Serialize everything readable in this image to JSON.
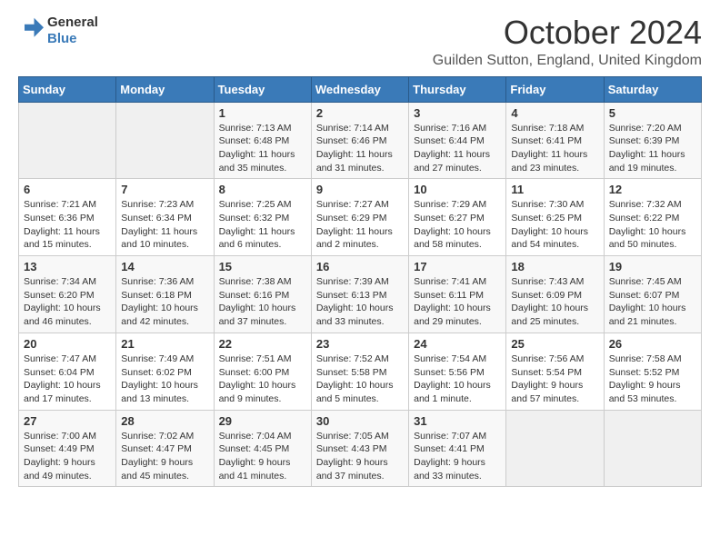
{
  "logo": {
    "text_general": "General",
    "text_blue": "Blue"
  },
  "header": {
    "month_title": "October 2024",
    "location": "Guilden Sutton, England, United Kingdom"
  },
  "days_of_week": [
    "Sunday",
    "Monday",
    "Tuesday",
    "Wednesday",
    "Thursday",
    "Friday",
    "Saturday"
  ],
  "weeks": [
    [
      {
        "day": "",
        "info": ""
      },
      {
        "day": "",
        "info": ""
      },
      {
        "day": "1",
        "info": "Sunrise: 7:13 AM\nSunset: 6:48 PM\nDaylight: 11 hours and 35 minutes."
      },
      {
        "day": "2",
        "info": "Sunrise: 7:14 AM\nSunset: 6:46 PM\nDaylight: 11 hours and 31 minutes."
      },
      {
        "day": "3",
        "info": "Sunrise: 7:16 AM\nSunset: 6:44 PM\nDaylight: 11 hours and 27 minutes."
      },
      {
        "day": "4",
        "info": "Sunrise: 7:18 AM\nSunset: 6:41 PM\nDaylight: 11 hours and 23 minutes."
      },
      {
        "day": "5",
        "info": "Sunrise: 7:20 AM\nSunset: 6:39 PM\nDaylight: 11 hours and 19 minutes."
      }
    ],
    [
      {
        "day": "6",
        "info": "Sunrise: 7:21 AM\nSunset: 6:36 PM\nDaylight: 11 hours and 15 minutes."
      },
      {
        "day": "7",
        "info": "Sunrise: 7:23 AM\nSunset: 6:34 PM\nDaylight: 11 hours and 10 minutes."
      },
      {
        "day": "8",
        "info": "Sunrise: 7:25 AM\nSunset: 6:32 PM\nDaylight: 11 hours and 6 minutes."
      },
      {
        "day": "9",
        "info": "Sunrise: 7:27 AM\nSunset: 6:29 PM\nDaylight: 11 hours and 2 minutes."
      },
      {
        "day": "10",
        "info": "Sunrise: 7:29 AM\nSunset: 6:27 PM\nDaylight: 10 hours and 58 minutes."
      },
      {
        "day": "11",
        "info": "Sunrise: 7:30 AM\nSunset: 6:25 PM\nDaylight: 10 hours and 54 minutes."
      },
      {
        "day": "12",
        "info": "Sunrise: 7:32 AM\nSunset: 6:22 PM\nDaylight: 10 hours and 50 minutes."
      }
    ],
    [
      {
        "day": "13",
        "info": "Sunrise: 7:34 AM\nSunset: 6:20 PM\nDaylight: 10 hours and 46 minutes."
      },
      {
        "day": "14",
        "info": "Sunrise: 7:36 AM\nSunset: 6:18 PM\nDaylight: 10 hours and 42 minutes."
      },
      {
        "day": "15",
        "info": "Sunrise: 7:38 AM\nSunset: 6:16 PM\nDaylight: 10 hours and 37 minutes."
      },
      {
        "day": "16",
        "info": "Sunrise: 7:39 AM\nSunset: 6:13 PM\nDaylight: 10 hours and 33 minutes."
      },
      {
        "day": "17",
        "info": "Sunrise: 7:41 AM\nSunset: 6:11 PM\nDaylight: 10 hours and 29 minutes."
      },
      {
        "day": "18",
        "info": "Sunrise: 7:43 AM\nSunset: 6:09 PM\nDaylight: 10 hours and 25 minutes."
      },
      {
        "day": "19",
        "info": "Sunrise: 7:45 AM\nSunset: 6:07 PM\nDaylight: 10 hours and 21 minutes."
      }
    ],
    [
      {
        "day": "20",
        "info": "Sunrise: 7:47 AM\nSunset: 6:04 PM\nDaylight: 10 hours and 17 minutes."
      },
      {
        "day": "21",
        "info": "Sunrise: 7:49 AM\nSunset: 6:02 PM\nDaylight: 10 hours and 13 minutes."
      },
      {
        "day": "22",
        "info": "Sunrise: 7:51 AM\nSunset: 6:00 PM\nDaylight: 10 hours and 9 minutes."
      },
      {
        "day": "23",
        "info": "Sunrise: 7:52 AM\nSunset: 5:58 PM\nDaylight: 10 hours and 5 minutes."
      },
      {
        "day": "24",
        "info": "Sunrise: 7:54 AM\nSunset: 5:56 PM\nDaylight: 10 hours and 1 minute."
      },
      {
        "day": "25",
        "info": "Sunrise: 7:56 AM\nSunset: 5:54 PM\nDaylight: 9 hours and 57 minutes."
      },
      {
        "day": "26",
        "info": "Sunrise: 7:58 AM\nSunset: 5:52 PM\nDaylight: 9 hours and 53 minutes."
      }
    ],
    [
      {
        "day": "27",
        "info": "Sunrise: 7:00 AM\nSunset: 4:49 PM\nDaylight: 9 hours and 49 minutes."
      },
      {
        "day": "28",
        "info": "Sunrise: 7:02 AM\nSunset: 4:47 PM\nDaylight: 9 hours and 45 minutes."
      },
      {
        "day": "29",
        "info": "Sunrise: 7:04 AM\nSunset: 4:45 PM\nDaylight: 9 hours and 41 minutes."
      },
      {
        "day": "30",
        "info": "Sunrise: 7:05 AM\nSunset: 4:43 PM\nDaylight: 9 hours and 37 minutes."
      },
      {
        "day": "31",
        "info": "Sunrise: 7:07 AM\nSunset: 4:41 PM\nDaylight: 9 hours and 33 minutes."
      },
      {
        "day": "",
        "info": ""
      },
      {
        "day": "",
        "info": ""
      }
    ]
  ]
}
